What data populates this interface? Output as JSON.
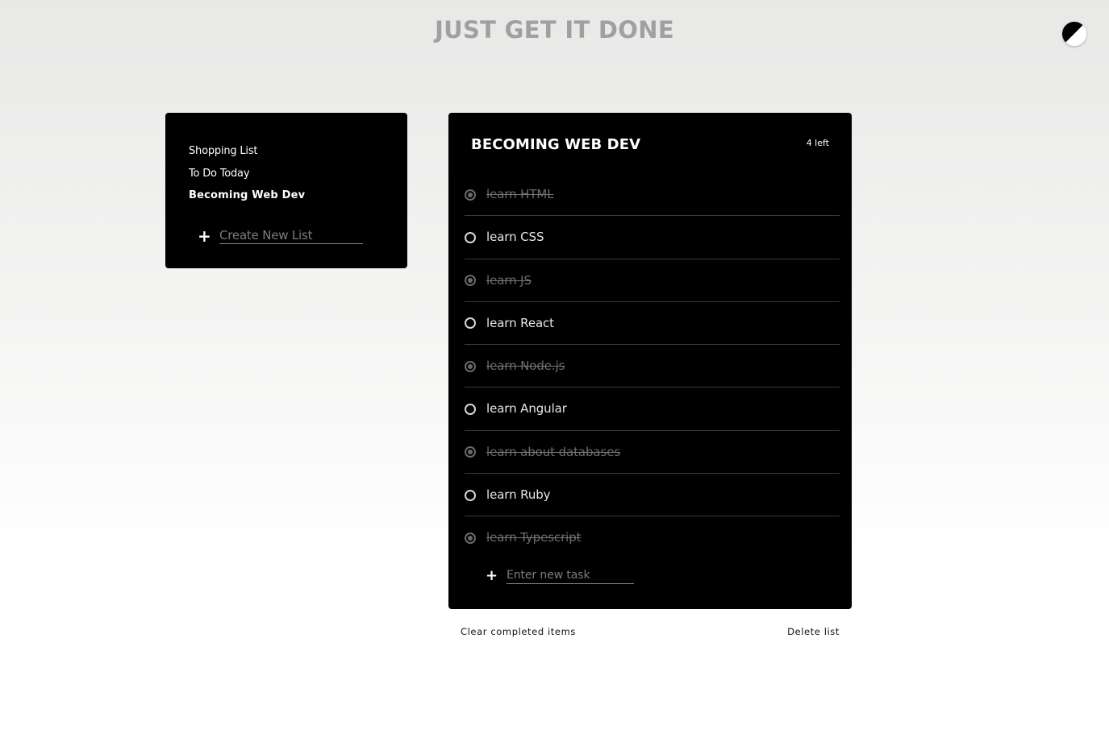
{
  "app": {
    "title": "JUST GET IT DONE",
    "theme_toggle_icon": "half-moon-contrast-icon"
  },
  "sidebar": {
    "lists": [
      {
        "label": "Shopping List",
        "active": false
      },
      {
        "label": "To Do Today",
        "active": false
      },
      {
        "label": "Becoming Web Dev",
        "active": true
      }
    ],
    "new_list": {
      "plus": "+",
      "placeholder": "Create New List",
      "value": ""
    }
  },
  "todo": {
    "title": "BECOMING WEB DEV",
    "count": "4 left",
    "tasks": [
      {
        "label": "learn HTML",
        "done": true
      },
      {
        "label": "learn CSS",
        "done": false
      },
      {
        "label": "learn JS",
        "done": true
      },
      {
        "label": "learn React",
        "done": false
      },
      {
        "label": "learn Node.js",
        "done": true
      },
      {
        "label": "learn Angular",
        "done": false
      },
      {
        "label": "learn about databases",
        "done": true
      },
      {
        "label": "learn Ruby",
        "done": false
      },
      {
        "label": "learn Typescript",
        "done": true
      }
    ],
    "new_task": {
      "plus": "+",
      "placeholder": "Enter new task",
      "value": ""
    }
  },
  "footer": {
    "clear_label": "Clear completed items",
    "delete_label": "Delete list"
  },
  "colors": {
    "panel": "#000000",
    "title": "#a0a0a0",
    "done_text": "#6c6c6c"
  }
}
